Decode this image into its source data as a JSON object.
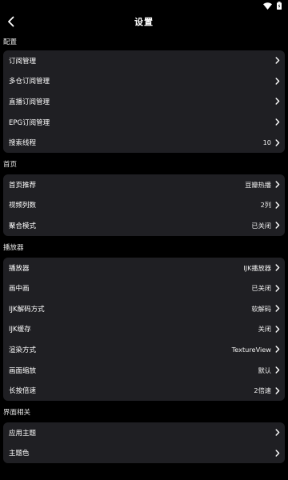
{
  "header": {
    "title": "设置"
  },
  "sections": [
    {
      "title": "配置",
      "rows": [
        {
          "label": "订阅管理",
          "value": ""
        },
        {
          "label": "多仓订阅管理",
          "value": ""
        },
        {
          "label": "直播订阅管理",
          "value": ""
        },
        {
          "label": "EPG订阅管理",
          "value": ""
        },
        {
          "label": "搜索线程",
          "value": "10"
        }
      ]
    },
    {
      "title": "首页",
      "rows": [
        {
          "label": "首页推荐",
          "value": "豆瓣热播"
        },
        {
          "label": "视频列数",
          "value": "2列"
        },
        {
          "label": "聚合模式",
          "value": "已关闭"
        }
      ]
    },
    {
      "title": "播放器",
      "rows": [
        {
          "label": "播放器",
          "value": "IJK播放器"
        },
        {
          "label": "画中画",
          "value": "已关闭"
        },
        {
          "label": "IJK解码方式",
          "value": "软解码"
        },
        {
          "label": "IJK缓存",
          "value": "关闭"
        },
        {
          "label": "渲染方式",
          "value": "TextureView"
        },
        {
          "label": "画面缩放",
          "value": "默认"
        },
        {
          "label": "长按倍速",
          "value": "2倍速"
        }
      ]
    },
    {
      "title": "界面相关",
      "rows": [
        {
          "label": "应用主题",
          "value": ""
        },
        {
          "label": "主题色",
          "value": ""
        }
      ]
    }
  ],
  "icons": {
    "back": "back-arrow-icon",
    "chevron": "chevron-right-icon",
    "wifi": "wifi-icon",
    "battery": "battery-icon"
  },
  "colors": {
    "background": "#000000",
    "card": "#1f1f23",
    "text": "#ffffff"
  }
}
